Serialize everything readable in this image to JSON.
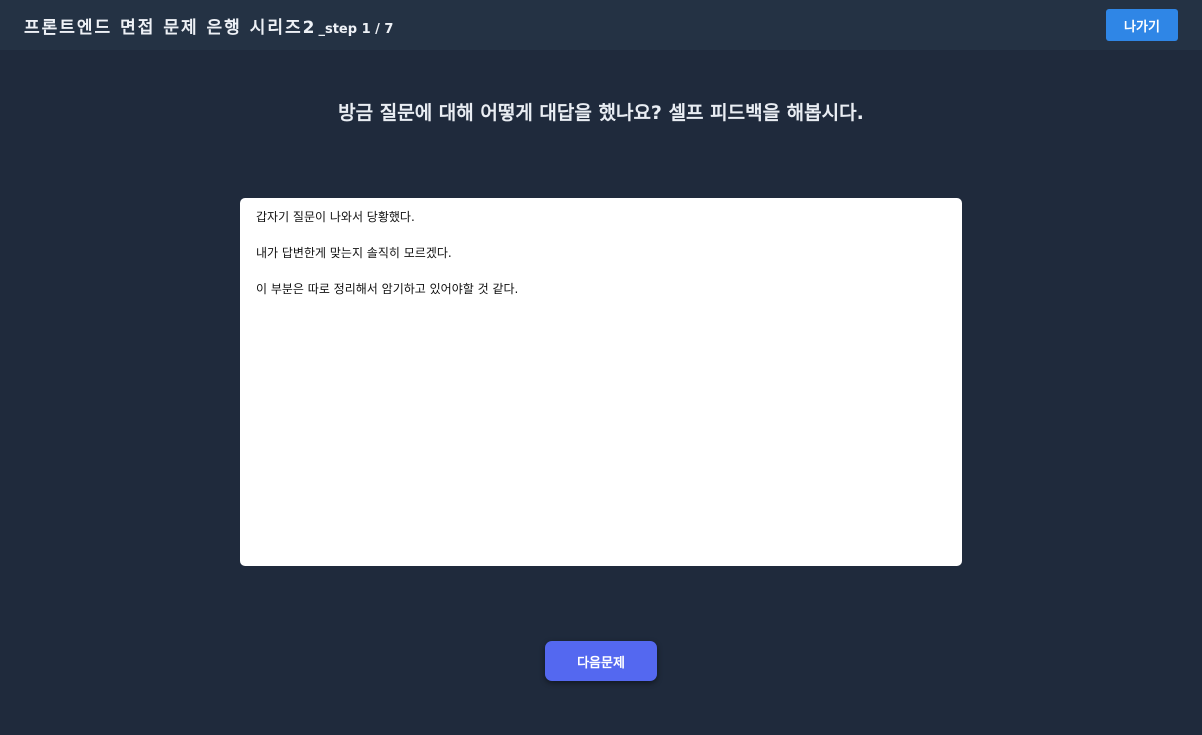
{
  "header": {
    "series_title": "프론트엔드 면접 문제 은행 시리즈2",
    "step_indicator": "_step 1 / 7",
    "exit_label": "나가기"
  },
  "main": {
    "question": "방금 질문에 대해 어떻게 대답을 했나요? 셀프 피드백을 해봅시다.",
    "feedback_text": "갑자기 질문이 나와서 당황했다.\n\n내가 답변한게 맞는지 솔직히 모르겠다.\n\n이 부분은 따로 정리해서 암기하고 있어야할 것 같다.",
    "next_label": "다음문제"
  },
  "colors": {
    "background": "#1f2a3c",
    "header_background": "#243244",
    "exit_button": "#2f86e6",
    "next_button": "#5468f0"
  }
}
